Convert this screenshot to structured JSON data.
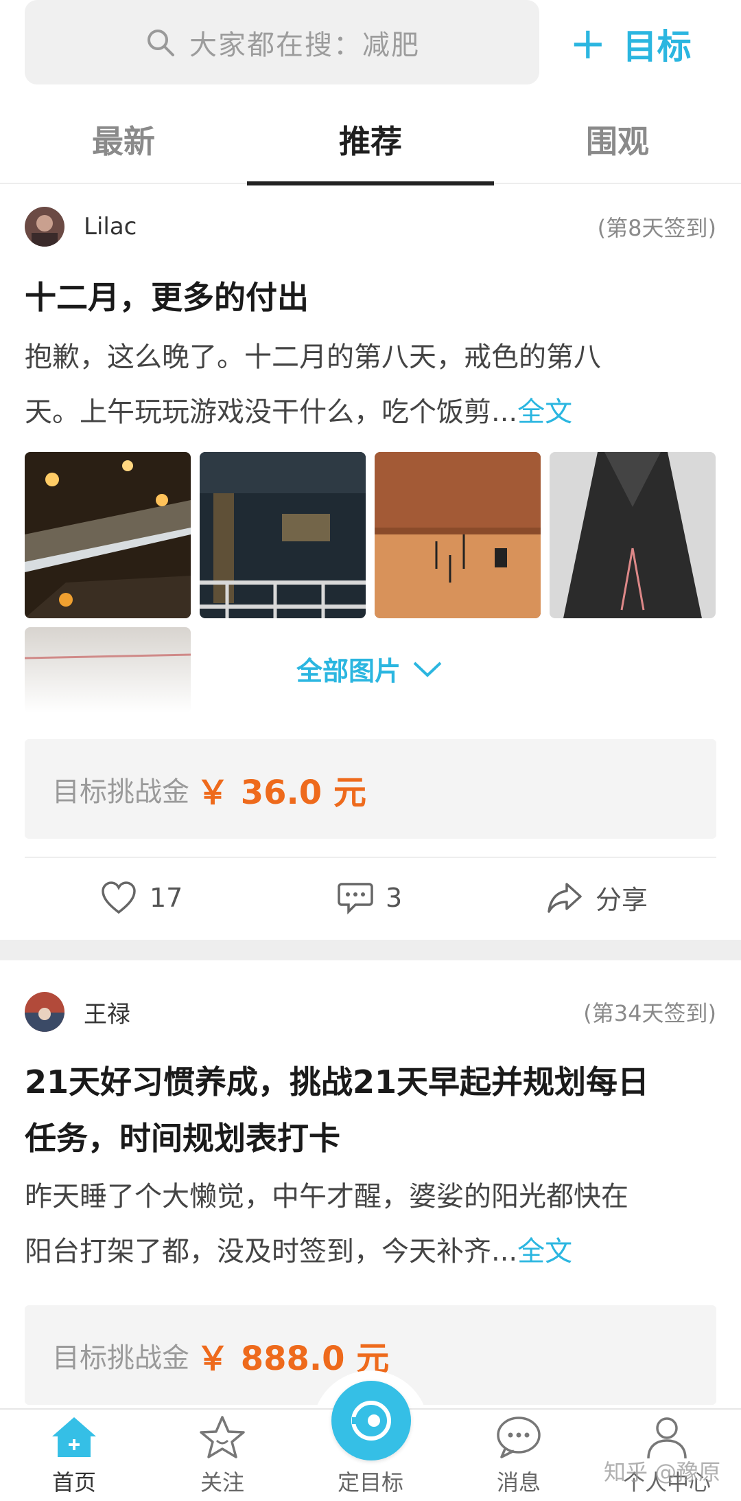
{
  "search": {
    "placeholder": "大家都在搜：减肥"
  },
  "header": {
    "add_goal_label": "目标"
  },
  "tabs": [
    {
      "label": "最新"
    },
    {
      "label": "推荐"
    },
    {
      "label": "围观"
    }
  ],
  "posts": [
    {
      "user": "Lilac",
      "checkin": "(第8天签到)",
      "title": "十二月，更多的付出",
      "body_line1": "抱歉，这么晚了。十二月的第八天，戒色的第八",
      "body_line2": "天。上午玩玩游戏没干什么，吃个饭剪...",
      "more_label": "全文",
      "all_pics_label": "全部图片",
      "reward_label": "目标挑战金",
      "reward_amount": "￥ 36.0 元",
      "likes": "17",
      "comments": "3",
      "share_label": "分享"
    },
    {
      "user": "王禄",
      "checkin": "(第34天签到)",
      "title_line1": "21天好习惯养成，挑战21天早起并规划每日",
      "title_line2": "任务，时间规划表打卡",
      "body_line1": "昨天睡了个大懒觉，中午才醒，婆娑的阳光都快在",
      "body_line2": "阳台打架了都，没及时签到，今天补齐...",
      "more_label": "全文",
      "reward_label": "目标挑战金",
      "reward_amount": "￥ 888.0 元"
    }
  ],
  "bottom_nav": [
    {
      "label": "首页"
    },
    {
      "label": "关注"
    },
    {
      "label": "定目标"
    },
    {
      "label": "消息"
    },
    {
      "label": "个人中心"
    }
  ],
  "watermark": "知乎 @豫原",
  "colors": {
    "accent": "#2bb6e0",
    "reward": "#ee6a1c"
  }
}
